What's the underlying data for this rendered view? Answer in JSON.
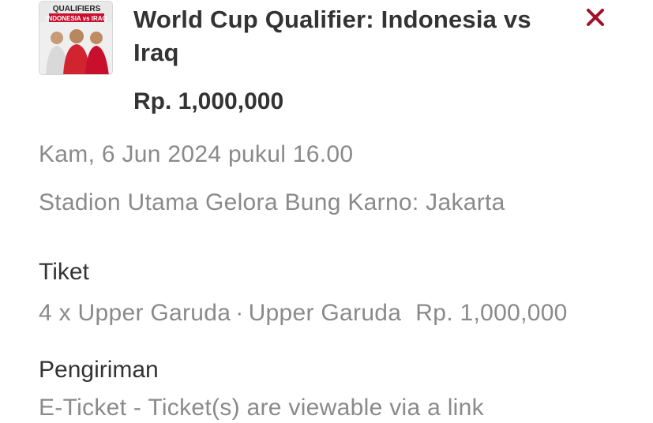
{
  "event": {
    "title": "World Cup Qualifier: Indonesia vs Iraq",
    "price": "Rp. 1,000,000",
    "thumbnail": {
      "icon": "event-poster-image",
      "top_text": "QUALIFIERS",
      "middle_text": "INDONESIA vs IRAQ"
    }
  },
  "close": {
    "icon": "close-icon",
    "color": "#a0112b"
  },
  "schedule": {
    "datetime": "Kam, 6 Jun 2024 pukul 16.00"
  },
  "venue": {
    "name": "Stadion Utama Gelora Bung Karno: Jakarta"
  },
  "ticket": {
    "heading": "Tiket",
    "quantity_label": "4 x Upper Garuda",
    "separator": "·",
    "category": "Upper Garuda",
    "price": "Rp. 1,000,000"
  },
  "delivery": {
    "heading": "Pengiriman",
    "text": "E-Ticket - Ticket(s) are viewable via a link"
  }
}
